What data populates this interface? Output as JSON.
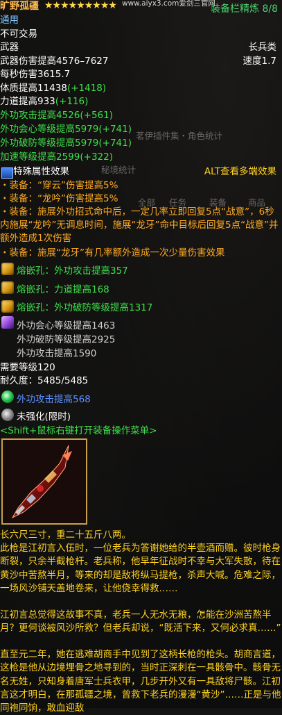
{
  "header": {
    "item_name": "旷野孤疆",
    "stars": "★★★★★★★★★",
    "watermark": "www.aiyx3.com爱剑三官网",
    "slot_info": "装备栏精炼 8/8"
  },
  "basic": {
    "category": "通用",
    "trade": "不可交易",
    "type": "武器",
    "weapon_kind": "长兵类",
    "damage": "武器伤害提高4576–7627",
    "speed": "速度1.7",
    "dps": "每秒伤害3615.7"
  },
  "attributes": [
    {
      "text": "体质提高11438",
      "bonus": "(+1418)",
      "color": "white"
    },
    {
      "text": "力道提高933",
      "bonus": "(+116)",
      "color": "white"
    },
    {
      "text": "外功攻击提高4526",
      "bonus": "(+561)",
      "color": "green"
    },
    {
      "text": "外功会心等级提高5979",
      "bonus": "(+741)",
      "color": "green"
    },
    {
      "text": "外功破防等级提高5979",
      "bonus": "(+741)",
      "color": "green"
    },
    {
      "text": "加速等级提高2599",
      "bonus": "(+322)",
      "color": "green"
    }
  ],
  "special": {
    "title": "特殊属性效果",
    "alt_hint": "ALT查看多端效果",
    "faded_plugin": "茗伊插件集・角色统计",
    "faded_tab": "秘境统计",
    "faded_menu": [
      "任务",
      "装备",
      "商品",
      "全部"
    ],
    "effects": [
      "・装备：“穿云”伤害提高5%",
      "・装备：“龙吟”伤害提高5%",
      "・装备：施展外功招式命中后，一定几率立即回复5点“战意”，6秒内施展“龙吟”无调息时间，施展“龙牙”命中目标后回复5点“战意”并额外造成1次伤害",
      "・装备：施展“龙牙”有几率额外造成一次少量伤害效果"
    ]
  },
  "gems": [
    {
      "label": "熔嵌孔：外功攻击提高357",
      "icon": "gold-gem-icon"
    },
    {
      "label": "熔嵌孔：力道提高168",
      "icon": "gold-gem-icon"
    },
    {
      "label": "熔嵌孔：外功破防等级提高1317",
      "icon": "gold-gem-icon"
    }
  ],
  "enchant_stats": [
    "外功会心等级提高1463",
    "外功破防等级提高2925",
    "外功攻击提高1590"
  ],
  "requirements": {
    "level": "需要等级120",
    "durability": "耐久度：5485/5485"
  },
  "enhancements": [
    {
      "label": "外功攻击提高568",
      "color": "blue"
    },
    {
      "label": "未强化(限时)",
      "color": "white"
    }
  ],
  "shortcut_hint": "<Shift+鼠标右键打开装备操作菜单>",
  "lore_paragraphs": [
    "长六尺三寸，重二十五斤八两。",
    "此枪是江初言入伍时，一位老兵为答谢她给的半壶酒而赠。彼时枪身断裂，只余半截枪杆。老兵称，他早年征战时不幸与大军失散，待在黄沙中苦熬半月，等来的却是敌将纵马提枪，杀声大喊。危难之际，一场风沙铺天盖地卷来，让他侥幸得救……",
    "江初言总觉得这故事不真，老兵一人无水无粮，怎能在沙洲苦熬半月？更何谈被风沙所救？但老兵却说，“既活下来，又何必求真……”",
    "直至元二年，她在逃难胡商手中见到了这柄长枪的枪头。胡商言道，这枪是他从边境埋骨之地寻到的，当时正深刺在一具骸骨中。骸骨无名无姓，只知身着唐军士兵衣甲，几步开外又有一具敌将尸骸。江初言这才明白，在那孤疆之境，曾救下老兵的漫漫“黄沙”……正是与他同袍同饷，敢血迎敌"
  ]
}
